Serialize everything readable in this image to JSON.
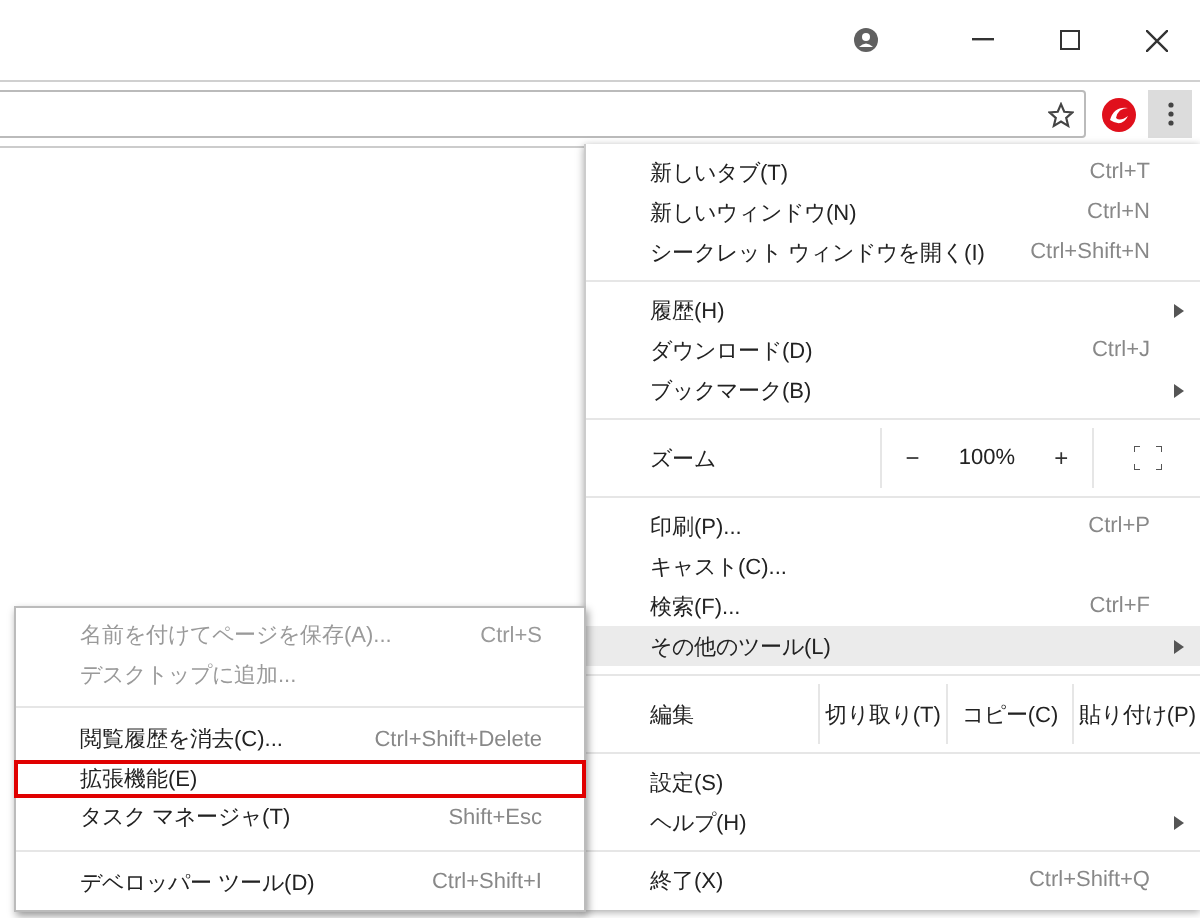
{
  "main_menu": {
    "items": [
      {
        "kind": "item",
        "label": "新しいタブ(T)",
        "shortcut": "Ctrl+T",
        "selected": false
      },
      {
        "kind": "item",
        "label": "新しいウィンドウ(N)",
        "shortcut": "Ctrl+N",
        "selected": false
      },
      {
        "kind": "item",
        "label": "シークレット ウィンドウを開く(I)",
        "shortcut": "Ctrl+Shift+N",
        "selected": false
      },
      {
        "kind": "separator"
      },
      {
        "kind": "item",
        "label": "履歴(H)",
        "submenu": true,
        "selected": false
      },
      {
        "kind": "item",
        "label": "ダウンロード(D)",
        "shortcut": "Ctrl+J",
        "selected": false
      },
      {
        "kind": "item",
        "label": "ブックマーク(B)",
        "submenu": true,
        "selected": false
      },
      {
        "kind": "separator"
      },
      {
        "kind": "zoom",
        "label": "ズーム",
        "minus": "−",
        "value": "100%",
        "plus": "+"
      },
      {
        "kind": "separator"
      },
      {
        "kind": "item",
        "label": "印刷(P)...",
        "shortcut": "Ctrl+P",
        "selected": false
      },
      {
        "kind": "item",
        "label": "キャスト(C)...",
        "selected": false
      },
      {
        "kind": "item",
        "label": "検索(F)...",
        "shortcut": "Ctrl+F",
        "selected": false
      },
      {
        "kind": "item",
        "label": "その他のツール(L)",
        "submenu": true,
        "selected": true
      },
      {
        "kind": "separator"
      },
      {
        "kind": "edit",
        "label": "編集",
        "buttons": [
          "切り取り(T)",
          "コピー(C)",
          "貼り付け(P)"
        ]
      },
      {
        "kind": "separator"
      },
      {
        "kind": "item",
        "label": "設定(S)",
        "selected": false
      },
      {
        "kind": "item",
        "label": "ヘルプ(H)",
        "submenu": true,
        "selected": false
      },
      {
        "kind": "separator"
      },
      {
        "kind": "item",
        "label": "終了(X)",
        "shortcut": "Ctrl+Shift+Q",
        "selected": false
      }
    ]
  },
  "submenu": {
    "items": [
      {
        "kind": "item",
        "label": "名前を付けてページを保存(A)...",
        "shortcut": "Ctrl+S",
        "disabled": true,
        "outlined": false
      },
      {
        "kind": "item",
        "label": "デスクトップに追加...",
        "disabled": true,
        "outlined": false
      },
      {
        "kind": "separator"
      },
      {
        "kind": "item",
        "label": "閲覧履歴を消去(C)...",
        "shortcut": "Ctrl+Shift+Delete",
        "disabled": false,
        "outlined": false
      },
      {
        "kind": "item",
        "label": "拡張機能(E)",
        "disabled": false,
        "outlined": true
      },
      {
        "kind": "item",
        "label": "タスク マネージャ(T)",
        "shortcut": "Shift+Esc",
        "disabled": false,
        "outlined": false
      },
      {
        "kind": "separator"
      },
      {
        "kind": "item",
        "label": "デベロッパー ツール(D)",
        "shortcut": "Ctrl+Shift+I",
        "disabled": false,
        "outlined": false
      }
    ]
  }
}
